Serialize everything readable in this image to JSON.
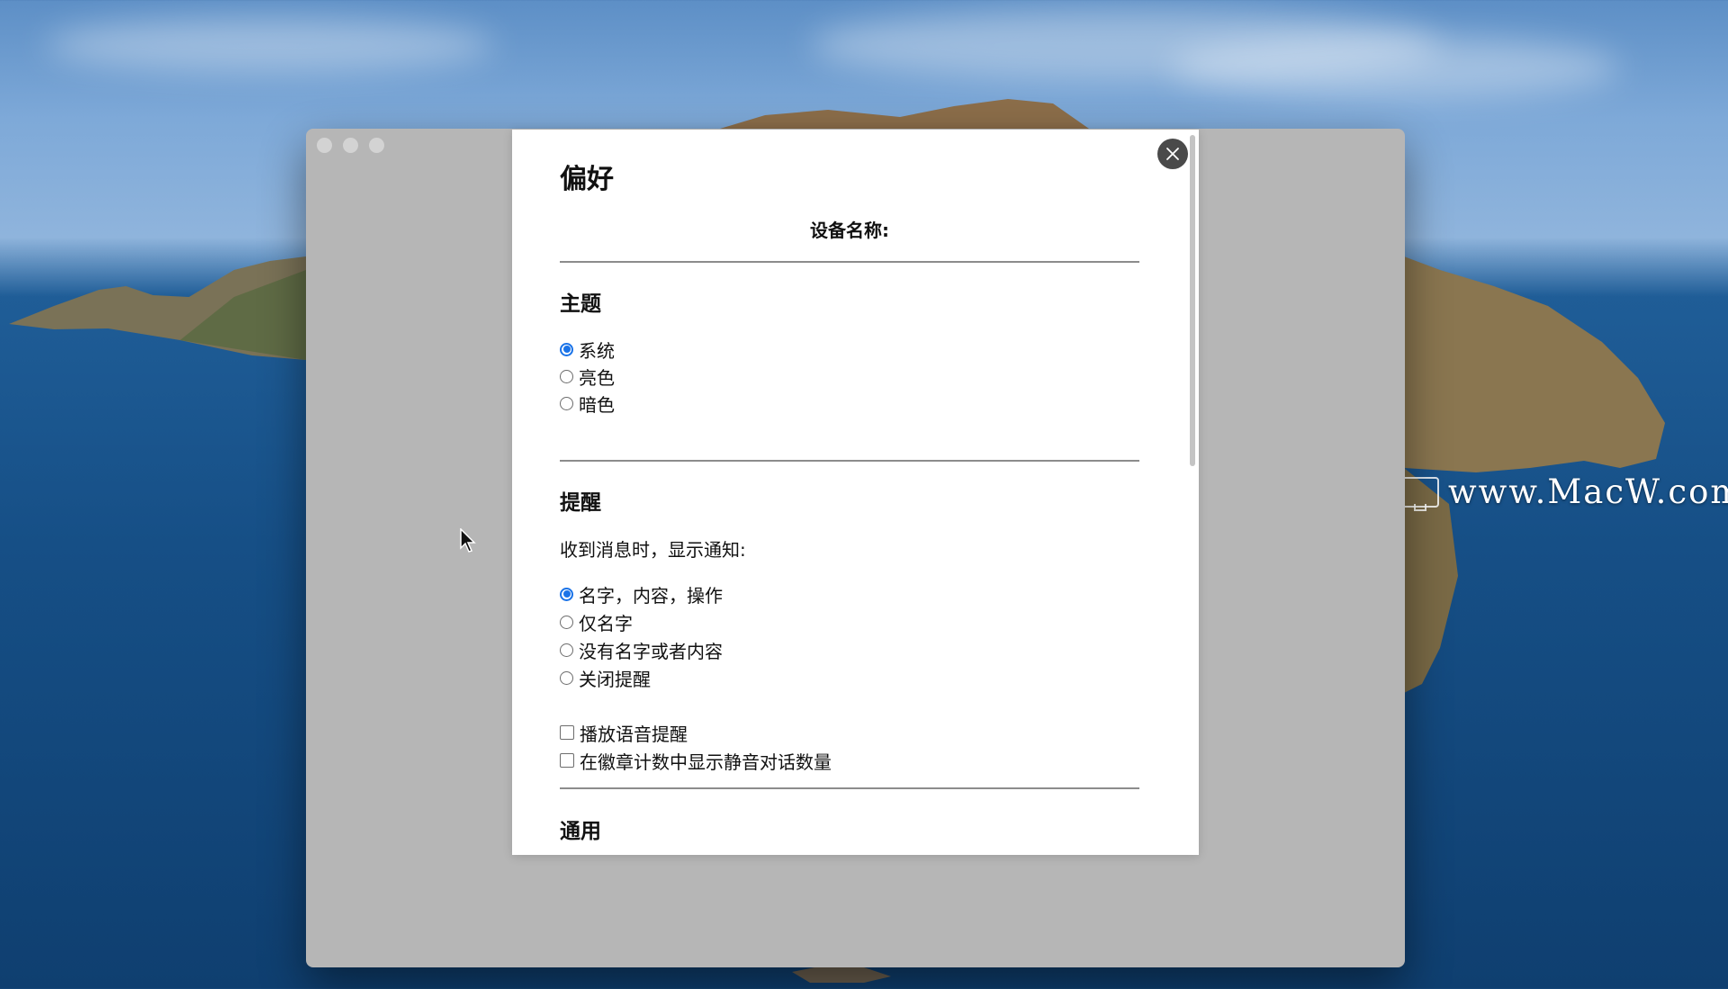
{
  "dialog": {
    "title": "偏好",
    "device_name_label": "设备名称:"
  },
  "theme": {
    "heading": "主题",
    "options": [
      {
        "label": "系统",
        "selected": true
      },
      {
        "label": "亮色",
        "selected": false
      },
      {
        "label": "暗色",
        "selected": false
      }
    ]
  },
  "notifications": {
    "heading": "提醒",
    "prompt": "收到消息时，显示通知:",
    "options": [
      {
        "label": "名字，内容，操作",
        "selected": true
      },
      {
        "label": "仅名字",
        "selected": false
      },
      {
        "label": "没有名字或者内容",
        "selected": false
      },
      {
        "label": "关闭提醒",
        "selected": false
      }
    ],
    "checkboxes": [
      {
        "label": "播放语音提醒",
        "checked": false
      },
      {
        "label": "在徽章计数中显示静音对话数量",
        "checked": false
      }
    ]
  },
  "general": {
    "heading": "通用"
  },
  "watermark": "www.MacW.com",
  "colors": {
    "accent": "#1a73e8",
    "close_button": "#4a4a4a",
    "window_bg": "#b6b6b6"
  },
  "icons": {
    "close": "close-icon",
    "cursor": "mouse-pointer-icon"
  }
}
